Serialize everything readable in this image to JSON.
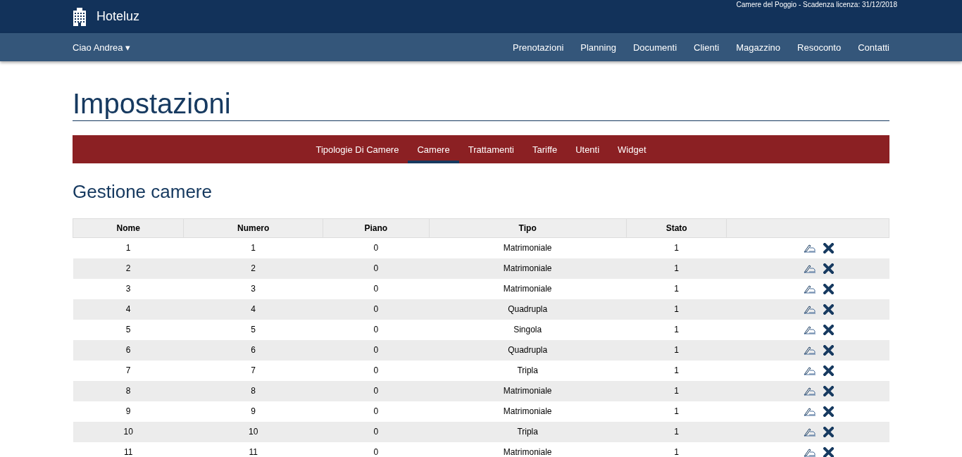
{
  "brand": "Hoteluz",
  "license": "Camere del Poggio - Scadenza licenza: 31/12/2018",
  "user_menu": "Ciao Andrea ▾",
  "nav": [
    "Prenotazioni",
    "Planning",
    "Documenti",
    "Clienti",
    "Magazzino",
    "Resoconto",
    "Contatti"
  ],
  "page_title": "Impostazioni",
  "tabs": [
    {
      "label": "Tipologie Di Camere",
      "selected": false
    },
    {
      "label": "Camere",
      "selected": true
    },
    {
      "label": "Trattamenti",
      "selected": false
    },
    {
      "label": "Tariffe",
      "selected": false
    },
    {
      "label": "Utenti",
      "selected": false
    },
    {
      "label": "Widget",
      "selected": false
    }
  ],
  "section_title": "Gestione camere",
  "table": {
    "columns": [
      "Nome",
      "Numero",
      "Piano",
      "Tipo",
      "Stato"
    ],
    "rows": [
      [
        "1",
        "1",
        "0",
        "Matrimoniale",
        "1"
      ],
      [
        "2",
        "2",
        "0",
        "Matrimoniale",
        "1"
      ],
      [
        "3",
        "3",
        "0",
        "Matrimoniale",
        "1"
      ],
      [
        "4",
        "4",
        "0",
        "Quadrupla",
        "1"
      ],
      [
        "5",
        "5",
        "0",
        "Singola",
        "1"
      ],
      [
        "6",
        "6",
        "0",
        "Quadrupla",
        "1"
      ],
      [
        "7",
        "7",
        "0",
        "Tripla",
        "1"
      ],
      [
        "8",
        "8",
        "0",
        "Matrimoniale",
        "1"
      ],
      [
        "9",
        "9",
        "0",
        "Matrimoniale",
        "1"
      ],
      [
        "10",
        "10",
        "0",
        "Tripla",
        "1"
      ],
      [
        "11",
        "11",
        "0",
        "Matrimoniale",
        "1"
      ]
    ]
  }
}
